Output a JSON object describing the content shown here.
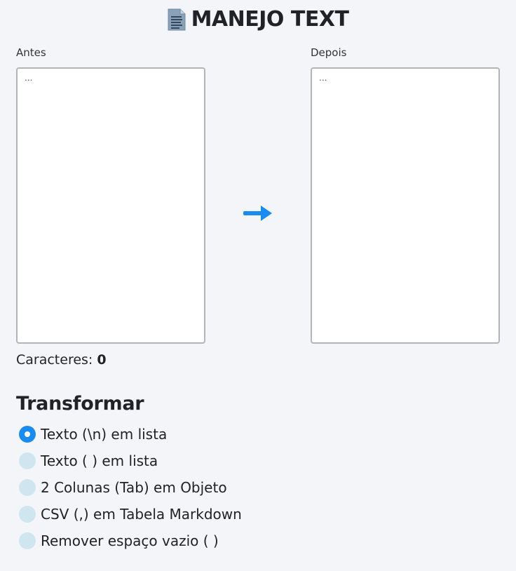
{
  "header": {
    "title": "MANEJO TEXT",
    "icon": "document-icon"
  },
  "editor": {
    "before_label": "Antes",
    "after_label": "Depois",
    "before_placeholder": "...",
    "after_placeholder": "...",
    "before_value": "",
    "after_value": "",
    "arrow_icon": "arrow-right-icon"
  },
  "counter": {
    "label": "Caracteres:",
    "value": "0"
  },
  "transform": {
    "title": "Transformar",
    "options": [
      {
        "label": "Texto (\\n) em lista",
        "checked": true
      },
      {
        "label": "Texto ( ) em lista",
        "checked": false
      },
      {
        "label": "2 Colunas (Tab) em Objeto",
        "checked": false
      },
      {
        "label": "CSV (,) em Tabela Markdown",
        "checked": false
      },
      {
        "label": "Remover espaço vazio ( )",
        "checked": false
      }
    ]
  },
  "colors": {
    "accent": "#1a8cf0",
    "radio_unchecked": "#cfe5ef",
    "background": "#f4f5f8"
  }
}
